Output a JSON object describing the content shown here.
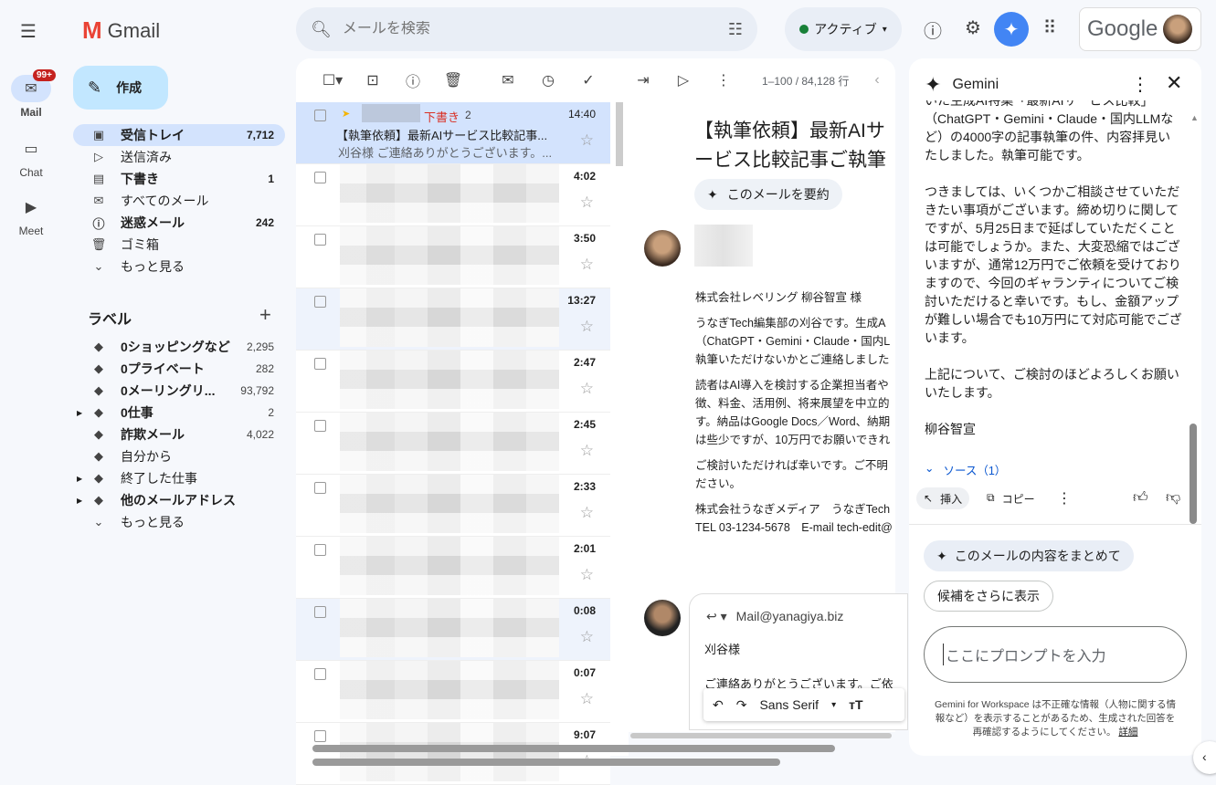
{
  "rail": {
    "mail": "Mail",
    "mail_badge": "99+",
    "chat": "Chat",
    "meet": "Meet"
  },
  "app": {
    "name": "Gmail"
  },
  "search": {
    "placeholder": "メールを検索"
  },
  "status": {
    "label": "アクティブ"
  },
  "account": {
    "brand": "Google"
  },
  "compose": {
    "label": "作成"
  },
  "nav": [
    {
      "label": "受信トレイ",
      "count": "7,712",
      "icon": "inbox"
    },
    {
      "label": "送信済み",
      "count": "",
      "icon": "send"
    },
    {
      "label": "下書き",
      "count": "1",
      "icon": "draft"
    },
    {
      "label": "すべてのメール",
      "count": "",
      "icon": "all-mail"
    },
    {
      "label": "迷惑メール",
      "count": "242",
      "icon": "spam"
    },
    {
      "label": "ゴミ箱",
      "count": "",
      "icon": "trash"
    },
    {
      "label": "もっと見る",
      "count": "",
      "icon": "chevron-down"
    }
  ],
  "labels_title": "ラベル",
  "labels": [
    {
      "label": "0ショッピングなど",
      "count": "2,295"
    },
    {
      "label": "0プライベート",
      "count": "282"
    },
    {
      "label": "0メーリングリ...",
      "count": "93,792"
    },
    {
      "label": "0仕事",
      "count": "2"
    },
    {
      "label": "詐欺メール",
      "count": "4,022"
    },
    {
      "label": "自分から",
      "count": ""
    },
    {
      "label": "終了した仕事",
      "count": ""
    },
    {
      "label": "他のメールアドレス",
      "count": ""
    },
    {
      "label": "もっと見る",
      "count": ""
    }
  ],
  "toolbar": {
    "pagination": "1–100 / 84,128 行"
  },
  "list": {
    "first": {
      "draft": "下書き",
      "count": "2",
      "time": "14:40",
      "subject": "【執筆依頼】最新AIサービス比較記事...",
      "snippet": "刈谷様 ご連絡ありがとうございます。..."
    },
    "times": [
      "4:02",
      "3:50",
      "13:27",
      "2:47",
      "2:45",
      "2:33",
      "2:01",
      "0:08",
      "0:07",
      "9:07"
    ]
  },
  "reader": {
    "subject": "【執筆依頼】最新AIサービス比較記事ご執筆のお願い",
    "summarize": "このメールを要約",
    "body": [
      "株式会社レベリング 柳谷智宣 様",
      "うなぎTech編集部の刈谷です。生成A",
      "（ChatGPT・Gemini・Claude・国内L",
      "執筆いただけないかとご連絡しました",
      "読者はAI導入を検討する企業担当者や",
      "徴、料金、活用例、将来展望を中立的",
      "す。納品はGoogle Docs／Word、納期",
      "は些少ですが、10万円でお願いできれ",
      "ご検討いただければ幸いです。ご不明",
      "ださい。",
      "株式会社うなぎメディア　うなぎTech",
      "TEL 03-1234-5678　E-mail tech-edit@"
    ],
    "reply_to": "Mail@yanagiya.biz",
    "reply_lines": [
      "刈谷様",
      "ご連絡ありがとうございます。ご依"
    ],
    "font": "Sans Serif"
  },
  "gemini": {
    "title": "Gemini",
    "paragraphs": [
      "いた生成AI特集「最新AIサービス比較」（ChatGPT・Gemini・Claude・国内LLMなど）の4000字の記事執筆の件、内容拝見いたしました。執筆可能です。",
      "つきましては、いくつかご相談させていただきたい事項がございます。締め切りに関してですが、5月25日まで延ばしていただくことは可能でしょうか。また、大変恐縮ではございますが、通常12万円でご依頼を受けておりますので、今回のギャランティについてご検討いただけると幸いです。もし、金額アップが難しい場合でも10万円にて対応可能でございます。",
      "上記について、ご検討のほどよろしくお願いいたします。",
      "柳谷智宣"
    ],
    "sources": "ソース（1）",
    "insert": "挿入",
    "copy": "コピー",
    "suggestion": "このメールの内容をまとめて",
    "more": "候補をさらに表示",
    "prompt_placeholder": "ここにプロンプトを入力",
    "disclaimer": "Gemini for Workspace は不正確な情報（人物に関する情報など）を表示することがあるため、生成された回答を再確認するようにしてください。",
    "details": "詳細"
  }
}
